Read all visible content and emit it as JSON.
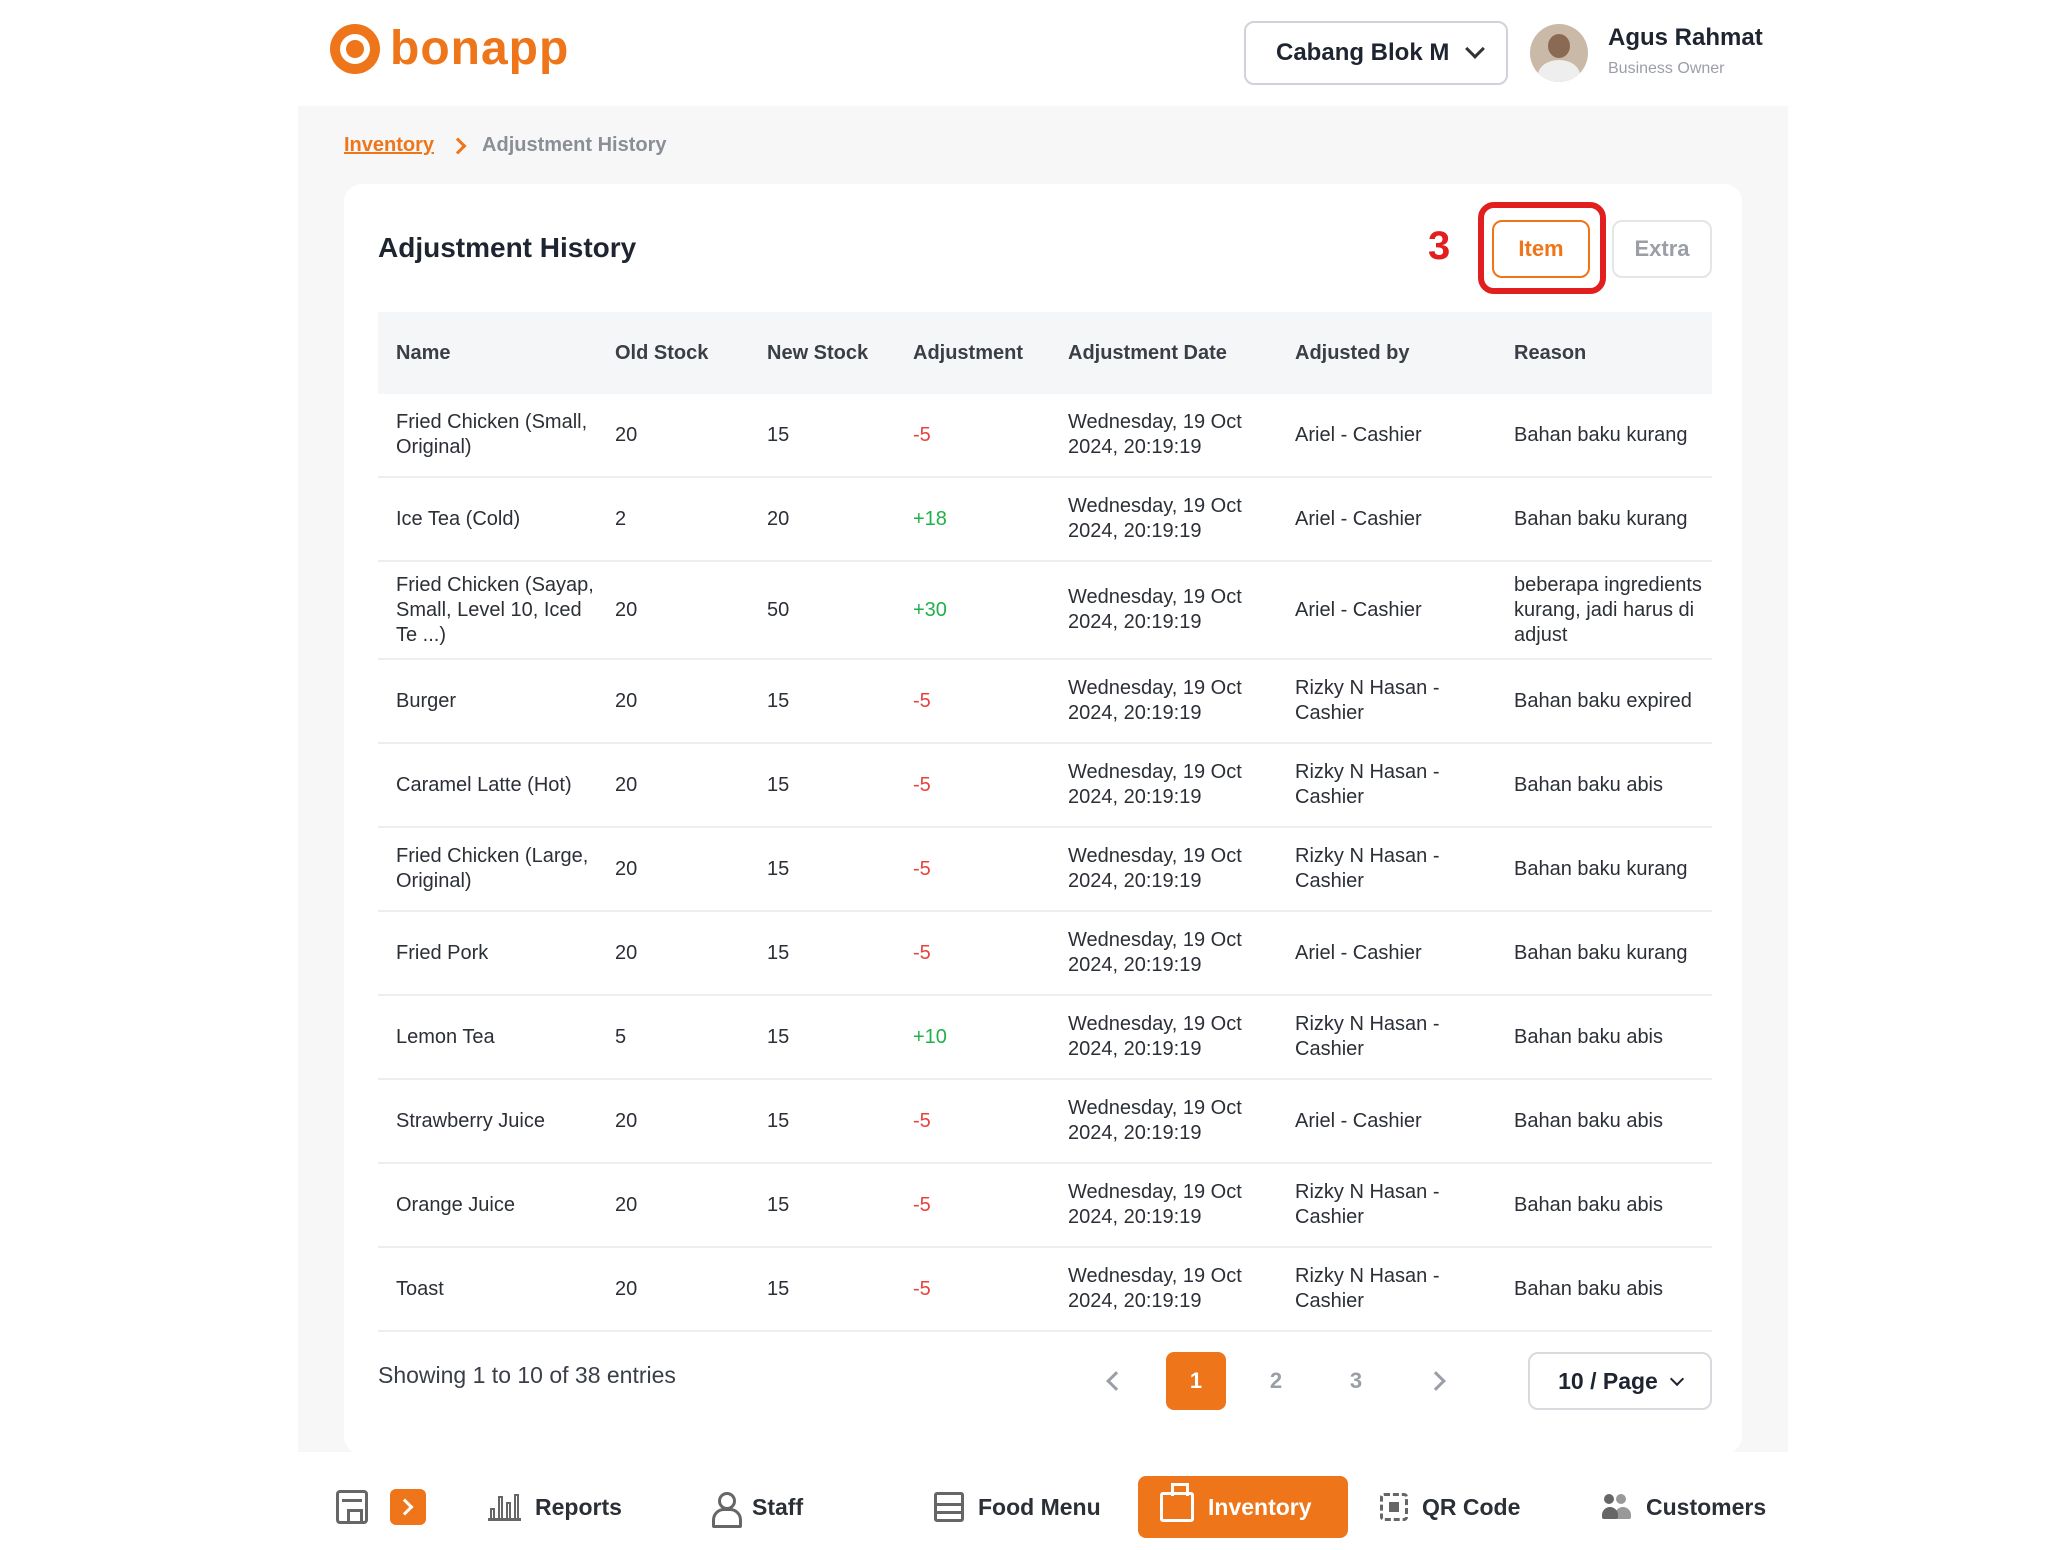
{
  "header": {
    "brand": "bonapp",
    "branch_selector": "Cabang Blok M",
    "user_name": "Agus Rahmat",
    "user_role": "Business Owner"
  },
  "breadcrumb": {
    "parent": "Inventory",
    "current": "Adjustment History"
  },
  "page": {
    "title": "Adjustment History",
    "annotation_step": "3",
    "tabs": {
      "item": "Item",
      "extra": "Extra"
    }
  },
  "table": {
    "columns": [
      "Name",
      "Old Stock",
      "New Stock",
      "Adjustment",
      "Adjustment Date",
      "Adjusted by",
      "Reason"
    ],
    "rows": [
      {
        "name": "Fried Chicken (Small, Original)",
        "old": "20",
        "new": "15",
        "adj": "-5",
        "date": "Wednesday, 19 Oct 2024, 20:19:19",
        "by": "Ariel - Cashier",
        "reason": "Bahan baku kurang"
      },
      {
        "name": "Ice Tea (Cold)",
        "old": "2",
        "new": "20",
        "adj": "+18",
        "date": "Wednesday, 19 Oct 2024, 20:19:19",
        "by": "Ariel - Cashier",
        "reason": "Bahan baku kurang"
      },
      {
        "name": "Fried Chicken (Sayap, Small, Level 10, Iced Te ...)",
        "old": "20",
        "new": "50",
        "adj": "+30",
        "date": "Wednesday, 19 Oct 2024, 20:19:19",
        "by": "Ariel - Cashier",
        "reason": "beberapa ingredients kurang, jadi harus di adjust"
      },
      {
        "name": "Burger",
        "old": "20",
        "new": "15",
        "adj": "-5",
        "date": "Wednesday, 19 Oct 2024, 20:19:19",
        "by": "Rizky N Hasan - Cashier",
        "reason": "Bahan baku expired"
      },
      {
        "name": "Caramel Latte (Hot)",
        "old": "20",
        "new": "15",
        "adj": "-5",
        "date": "Wednesday, 19 Oct 2024, 20:19:19",
        "by": "Rizky N Hasan - Cashier",
        "reason": "Bahan baku abis"
      },
      {
        "name": "Fried Chicken (Large, Original)",
        "old": "20",
        "new": "15",
        "adj": "-5",
        "date": "Wednesday, 19 Oct 2024, 20:19:19",
        "by": "Rizky N Hasan - Cashier",
        "reason": "Bahan baku kurang"
      },
      {
        "name": "Fried Pork",
        "old": "20",
        "new": "15",
        "adj": "-5",
        "date": "Wednesday, 19 Oct 2024, 20:19:19",
        "by": "Ariel - Cashier",
        "reason": "Bahan baku kurang"
      },
      {
        "name": "Lemon Tea",
        "old": "5",
        "new": "15",
        "adj": "+10",
        "date": "Wednesday, 19 Oct 2024, 20:19:19",
        "by": "Rizky N Hasan - Cashier",
        "reason": "Bahan baku abis"
      },
      {
        "name": "Strawberry Juice",
        "old": "20",
        "new": "15",
        "adj": "-5",
        "date": "Wednesday, 19 Oct 2024, 20:19:19",
        "by": "Ariel - Cashier",
        "reason": "Bahan baku abis"
      },
      {
        "name": "Orange Juice",
        "old": "20",
        "new": "15",
        "adj": "-5",
        "date": "Wednesday, 19 Oct 2024, 20:19:19",
        "by": "Rizky N Hasan - Cashier",
        "reason": "Bahan baku abis"
      },
      {
        "name": "Toast",
        "old": "20",
        "new": "15",
        "adj": "-5",
        "date": "Wednesday, 19 Oct 2024, 20:19:19",
        "by": "Rizky N Hasan - Cashier",
        "reason": "Bahan baku abis"
      }
    ]
  },
  "pagination": {
    "summary": "Showing 1 to 10 of 38 entries",
    "pages": [
      "1",
      "2",
      "3"
    ],
    "current_page": "1",
    "per_page": "10 / Page"
  },
  "bottom_nav": {
    "items": [
      "Reports",
      "Staff",
      "Food Menu",
      "Inventory",
      "QR Code",
      "Customers"
    ],
    "active": "Inventory"
  },
  "colors": {
    "accent": "#ee7519",
    "negative": "#e8423a",
    "positive": "#22b04a",
    "annotation": "#e21f1f"
  },
  "icons": [
    "store-icon",
    "expand-arrow-icon",
    "reports-icon",
    "staff-icon",
    "food-menu-icon",
    "inventory-icon",
    "qr-code-icon",
    "customers-icon",
    "chevron-down-icon",
    "chevron-right-icon",
    "chevron-left-icon"
  ]
}
